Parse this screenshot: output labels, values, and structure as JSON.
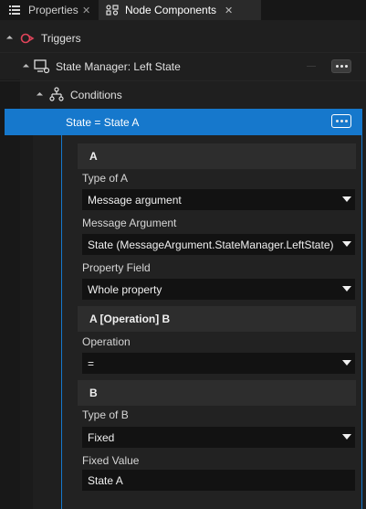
{
  "tabs": {
    "properties": "Properties",
    "node_components": "Node Components",
    "close_glyph": "✕"
  },
  "tree": {
    "triggers": "Triggers",
    "state_manager": "State Manager: Left State",
    "conditions": "Conditions",
    "condition_item": "State = State A"
  },
  "panel": {
    "section_a": "A",
    "type_of_a_label": "Type of A",
    "type_of_a_value": "Message argument",
    "message_argument_label": "Message Argument",
    "message_argument_value": "State (MessageArgument.StateManager.LeftState)",
    "property_field_label": "Property Field",
    "property_field_value": "Whole property",
    "section_operation": "A [Operation] B",
    "operation_label": "Operation",
    "operation_value": "=",
    "section_b": "B",
    "type_of_b_label": "Type of B",
    "type_of_b_value": "Fixed",
    "fixed_value_label": "Fixed Value",
    "fixed_value_value": "State A"
  },
  "colors": {
    "accent": "#1678cc",
    "trigger_icon": "#e0445a"
  },
  "icons": {
    "properties_tab": "list-icon",
    "node_components_tab": "components-icon",
    "triggers": "trigger-icon",
    "state_manager": "state-manager-icon",
    "conditions": "conditions-icon",
    "more": "ellipsis-icon"
  }
}
